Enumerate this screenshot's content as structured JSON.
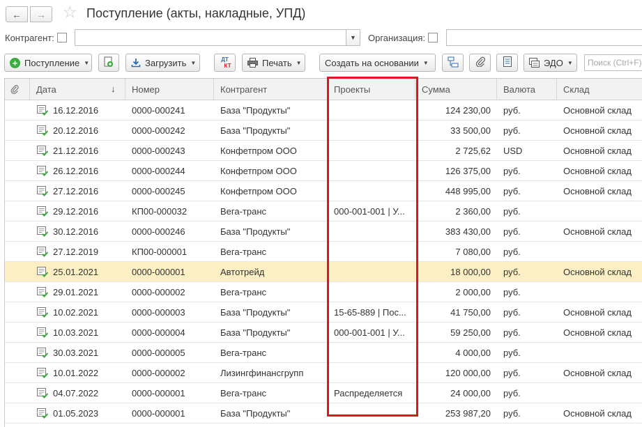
{
  "window": {
    "title": "Поступление (акты, накладные, УПД)"
  },
  "filters": {
    "contractor_label": "Контрагент:",
    "contractor_value": "",
    "organization_label": "Организация:",
    "organization_value": ""
  },
  "toolbar": {
    "receipt_label": "Поступление",
    "load_label": "Загрузить",
    "print_label": "Печать",
    "create_basis_label": "Создать на основании",
    "edo_label": "ЭДО",
    "search_placeholder": "Поиск (Ctrl+F)",
    "dtkt_top": "ДТ",
    "dtkt_bottom": "КТ"
  },
  "table": {
    "columns": [
      "Дата",
      "Номер",
      "Контрагент",
      "Проекты",
      "Сумма",
      "Валюта",
      "Склад"
    ],
    "sort_indicator": "↓",
    "rows": [
      {
        "date": "16.12.2016",
        "number": "0000-000241",
        "contractor": "База \"Продукты\"",
        "project": "",
        "sum": "124 230,00",
        "currency": "руб.",
        "warehouse": "Основной склад"
      },
      {
        "date": "20.12.2016",
        "number": "0000-000242",
        "contractor": "База \"Продукты\"",
        "project": "",
        "sum": "33 500,00",
        "currency": "руб.",
        "warehouse": "Основной склад"
      },
      {
        "date": "21.12.2016",
        "number": "0000-000243",
        "contractor": "Конфетпром ООО",
        "project": "",
        "sum": "2 725,62",
        "currency": "USD",
        "warehouse": "Основной склад"
      },
      {
        "date": "26.12.2016",
        "number": "0000-000244",
        "contractor": "Конфетпром ООО",
        "project": "",
        "sum": "126 375,00",
        "currency": "руб.",
        "warehouse": "Основной склад"
      },
      {
        "date": "27.12.2016",
        "number": "0000-000245",
        "contractor": "Конфетпром ООО",
        "project": "",
        "sum": "448 995,00",
        "currency": "руб.",
        "warehouse": "Основной склад"
      },
      {
        "date": "29.12.2016",
        "number": "КП00-000032",
        "contractor": "Вега-транс",
        "project": "000-001-001 | У...",
        "sum": "2 360,00",
        "currency": "руб.",
        "warehouse": ""
      },
      {
        "date": "30.12.2016",
        "number": "0000-000246",
        "contractor": "База \"Продукты\"",
        "project": "",
        "sum": "383 430,00",
        "currency": "руб.",
        "warehouse": "Основной склад"
      },
      {
        "date": "27.12.2019",
        "number": "КП00-000001",
        "contractor": "Вега-транс",
        "project": "",
        "sum": "7 080,00",
        "currency": "руб.",
        "warehouse": ""
      },
      {
        "date": "25.01.2021",
        "number": "0000-000001",
        "contractor": "Автотрейд",
        "project": "",
        "sum": "18 000,00",
        "currency": "руб.",
        "warehouse": "Основной склад",
        "selected": true
      },
      {
        "date": "29.01.2021",
        "number": "0000-000002",
        "contractor": "Вега-транс",
        "project": "",
        "sum": "2 000,00",
        "currency": "руб.",
        "warehouse": ""
      },
      {
        "date": "10.02.2021",
        "number": "0000-000003",
        "contractor": "База \"Продукты\"",
        "project": "15-65-889 | Пос...",
        "sum": "41 750,00",
        "currency": "руб.",
        "warehouse": "Основной склад"
      },
      {
        "date": "10.03.2021",
        "number": "0000-000004",
        "contractor": "База \"Продукты\"",
        "project": "000-001-001 | У...",
        "sum": "59 250,00",
        "currency": "руб.",
        "warehouse": "Основной склад"
      },
      {
        "date": "30.03.2021",
        "number": "0000-000005",
        "contractor": "Вега-транс",
        "project": "",
        "sum": "4 000,00",
        "currency": "руб.",
        "warehouse": ""
      },
      {
        "date": "10.01.2022",
        "number": "0000-000002",
        "contractor": "Лизингфинансгрупп",
        "project": "",
        "sum": "120 000,00",
        "currency": "руб.",
        "warehouse": "Основной склад"
      },
      {
        "date": "04.07.2022",
        "number": "0000-000001",
        "contractor": "Вега-транс",
        "project": "Распределяется",
        "sum": "24 000,00",
        "currency": "руб.",
        "warehouse": ""
      },
      {
        "date": "01.05.2023",
        "number": "0000-000001",
        "contractor": "База \"Продукты\"",
        "project": "",
        "sum": "253 987,20",
        "currency": "руб.",
        "warehouse": "Основной склад"
      }
    ]
  },
  "colors": {
    "highlight": "#e2141d",
    "selected_row": "#fbefc3",
    "accent_green": "#3bab3b"
  }
}
